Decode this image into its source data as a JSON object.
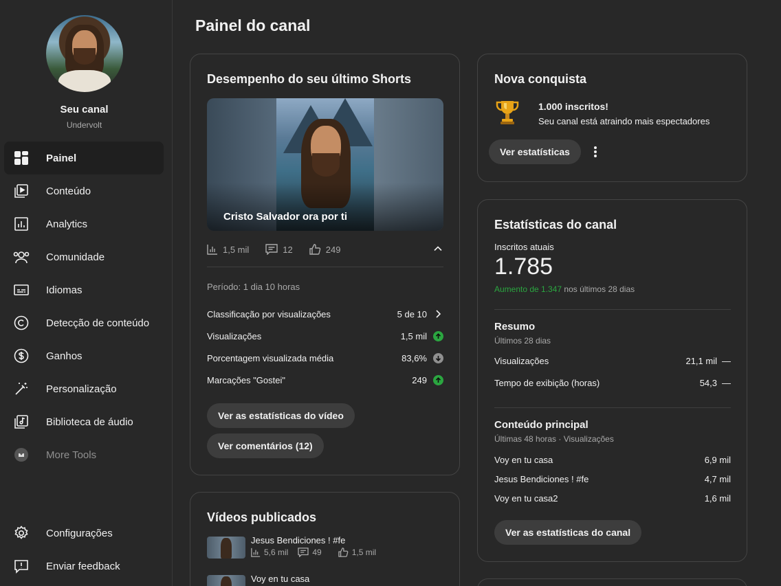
{
  "sidebar": {
    "channel_name": "Seu canal",
    "channel_handle": "Undervolt",
    "items": [
      {
        "label": "Painel",
        "icon": "dashboard-icon"
      },
      {
        "label": "Conteúdo",
        "icon": "content-icon"
      },
      {
        "label": "Analytics",
        "icon": "analytics-icon"
      },
      {
        "label": "Comunidade",
        "icon": "community-icon"
      },
      {
        "label": "Idiomas",
        "icon": "subtitles-icon"
      },
      {
        "label": "Detecção de conteúdo",
        "icon": "copyright-icon"
      },
      {
        "label": "Ganhos",
        "icon": "dollar-icon"
      },
      {
        "label": "Personalização",
        "icon": "magic-wand-icon"
      },
      {
        "label": "Biblioteca de áudio",
        "icon": "audio-library-icon"
      },
      {
        "label": "More Tools",
        "icon": "more-tools-icon"
      }
    ],
    "bottom": [
      {
        "label": "Configurações",
        "icon": "gear-icon"
      },
      {
        "label": "Enviar feedback",
        "icon": "feedback-icon"
      }
    ]
  },
  "page_title": "Painel do canal",
  "shorts": {
    "title": "Desempenho do seu último Shorts",
    "video_title": "Cristo Salvador ora por ti",
    "views": "1,5 mil",
    "comments": "12",
    "likes": "249",
    "period": "Período: 1 dia 10 horas",
    "metrics": [
      {
        "label": "Classificação por visualizações",
        "value": "5 de 10",
        "indicator": "chevron-right"
      },
      {
        "label": "Visualizações",
        "value": "1,5 mil",
        "indicator": "up"
      },
      {
        "label": "Porcentagem visualizada média",
        "value": "83,6%",
        "indicator": "down"
      },
      {
        "label": "Marcações \"Gostei\"",
        "value": "249",
        "indicator": "up"
      }
    ],
    "btn_stats": "Ver as estatísticas do vídeo",
    "btn_comments": "Ver comentários (12)"
  },
  "published": {
    "title": "Vídeos publicados",
    "items": [
      {
        "title": "Jesus Bendiciones ! #fe",
        "views": "5,6 mil",
        "comments": "49",
        "likes": "1,5 mil"
      },
      {
        "title": "Voy en tu casa"
      }
    ]
  },
  "achievement": {
    "title": "Nova conquista",
    "headline": "1.000 inscritos!",
    "subtitle": "Seu canal está atraindo mais espectadores",
    "button": "Ver estatísticas"
  },
  "channel_stats": {
    "title": "Estatísticas do canal",
    "subs_label": "Inscritos atuais",
    "subs_value": "1.785",
    "growth_value": "Aumento de 1.347",
    "growth_suffix": " nos últimos 28 dias",
    "summary_title": "Resumo",
    "summary_sub": "Últimos 28 dias",
    "summary_rows": [
      {
        "label": "Visualizações",
        "value": "21,1 mil",
        "trend": "—"
      },
      {
        "label": "Tempo de exibição (horas)",
        "value": "54,3",
        "trend": "—"
      }
    ],
    "top_title": "Conteúdo principal",
    "top_sub": "Últimas 48 horas · Visualizações",
    "top_rows": [
      {
        "label": "Voy en tu casa",
        "value": "6,9 mil"
      },
      {
        "label": "Jesus Bendiciones ! #fe",
        "value": "4,7 mil"
      },
      {
        "label": "Voy en tu casa2",
        "value": "1,6 mil"
      }
    ],
    "button": "Ver as estatísticas do canal"
  },
  "colors": {
    "background": "#282828",
    "up": "#2ba640",
    "down": "#909090",
    "growth": "#2ba640"
  }
}
